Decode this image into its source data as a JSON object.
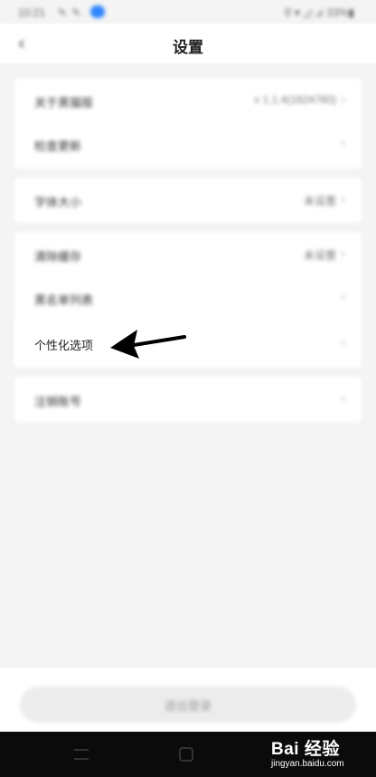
{
  "status_bar": {
    "time": "10:21",
    "notifications": "✎ ✎",
    "extra": "•",
    "right_icons": "⚲ ▾ ◿ ⊿ 33%▮"
  },
  "header": {
    "title": "设置"
  },
  "groups": [
    {
      "rows": [
        {
          "label": "关于黑猫版",
          "value": "v 1.1.4(1624760)",
          "chevron": "›"
        },
        {
          "label": "检查更新",
          "value": "",
          "chevron": "›"
        }
      ]
    },
    {
      "rows": [
        {
          "label": "字体大小",
          "value": "未设置",
          "chevron": "›"
        }
      ]
    },
    {
      "rows": [
        {
          "label": "清除缓存",
          "value": "未设置",
          "chevron": "›"
        },
        {
          "label": "黑名单列表",
          "value": "",
          "chevron": "›"
        },
        {
          "label": "个性化选项",
          "value": "",
          "chevron": "›"
        }
      ]
    },
    {
      "rows": [
        {
          "label": "注销账号",
          "value": "",
          "chevron": "›"
        }
      ]
    }
  ],
  "bottom": {
    "logout_label": "退出登录"
  },
  "watermark": {
    "main": "Bai 经验",
    "url": "jingyan.baidu.com"
  },
  "colors": {
    "background": "#f4f4f4",
    "card": "#ffffff",
    "nav_bar": "#0b0b0b",
    "accent_badge": "#2f86ff",
    "arrow": "#000000"
  }
}
